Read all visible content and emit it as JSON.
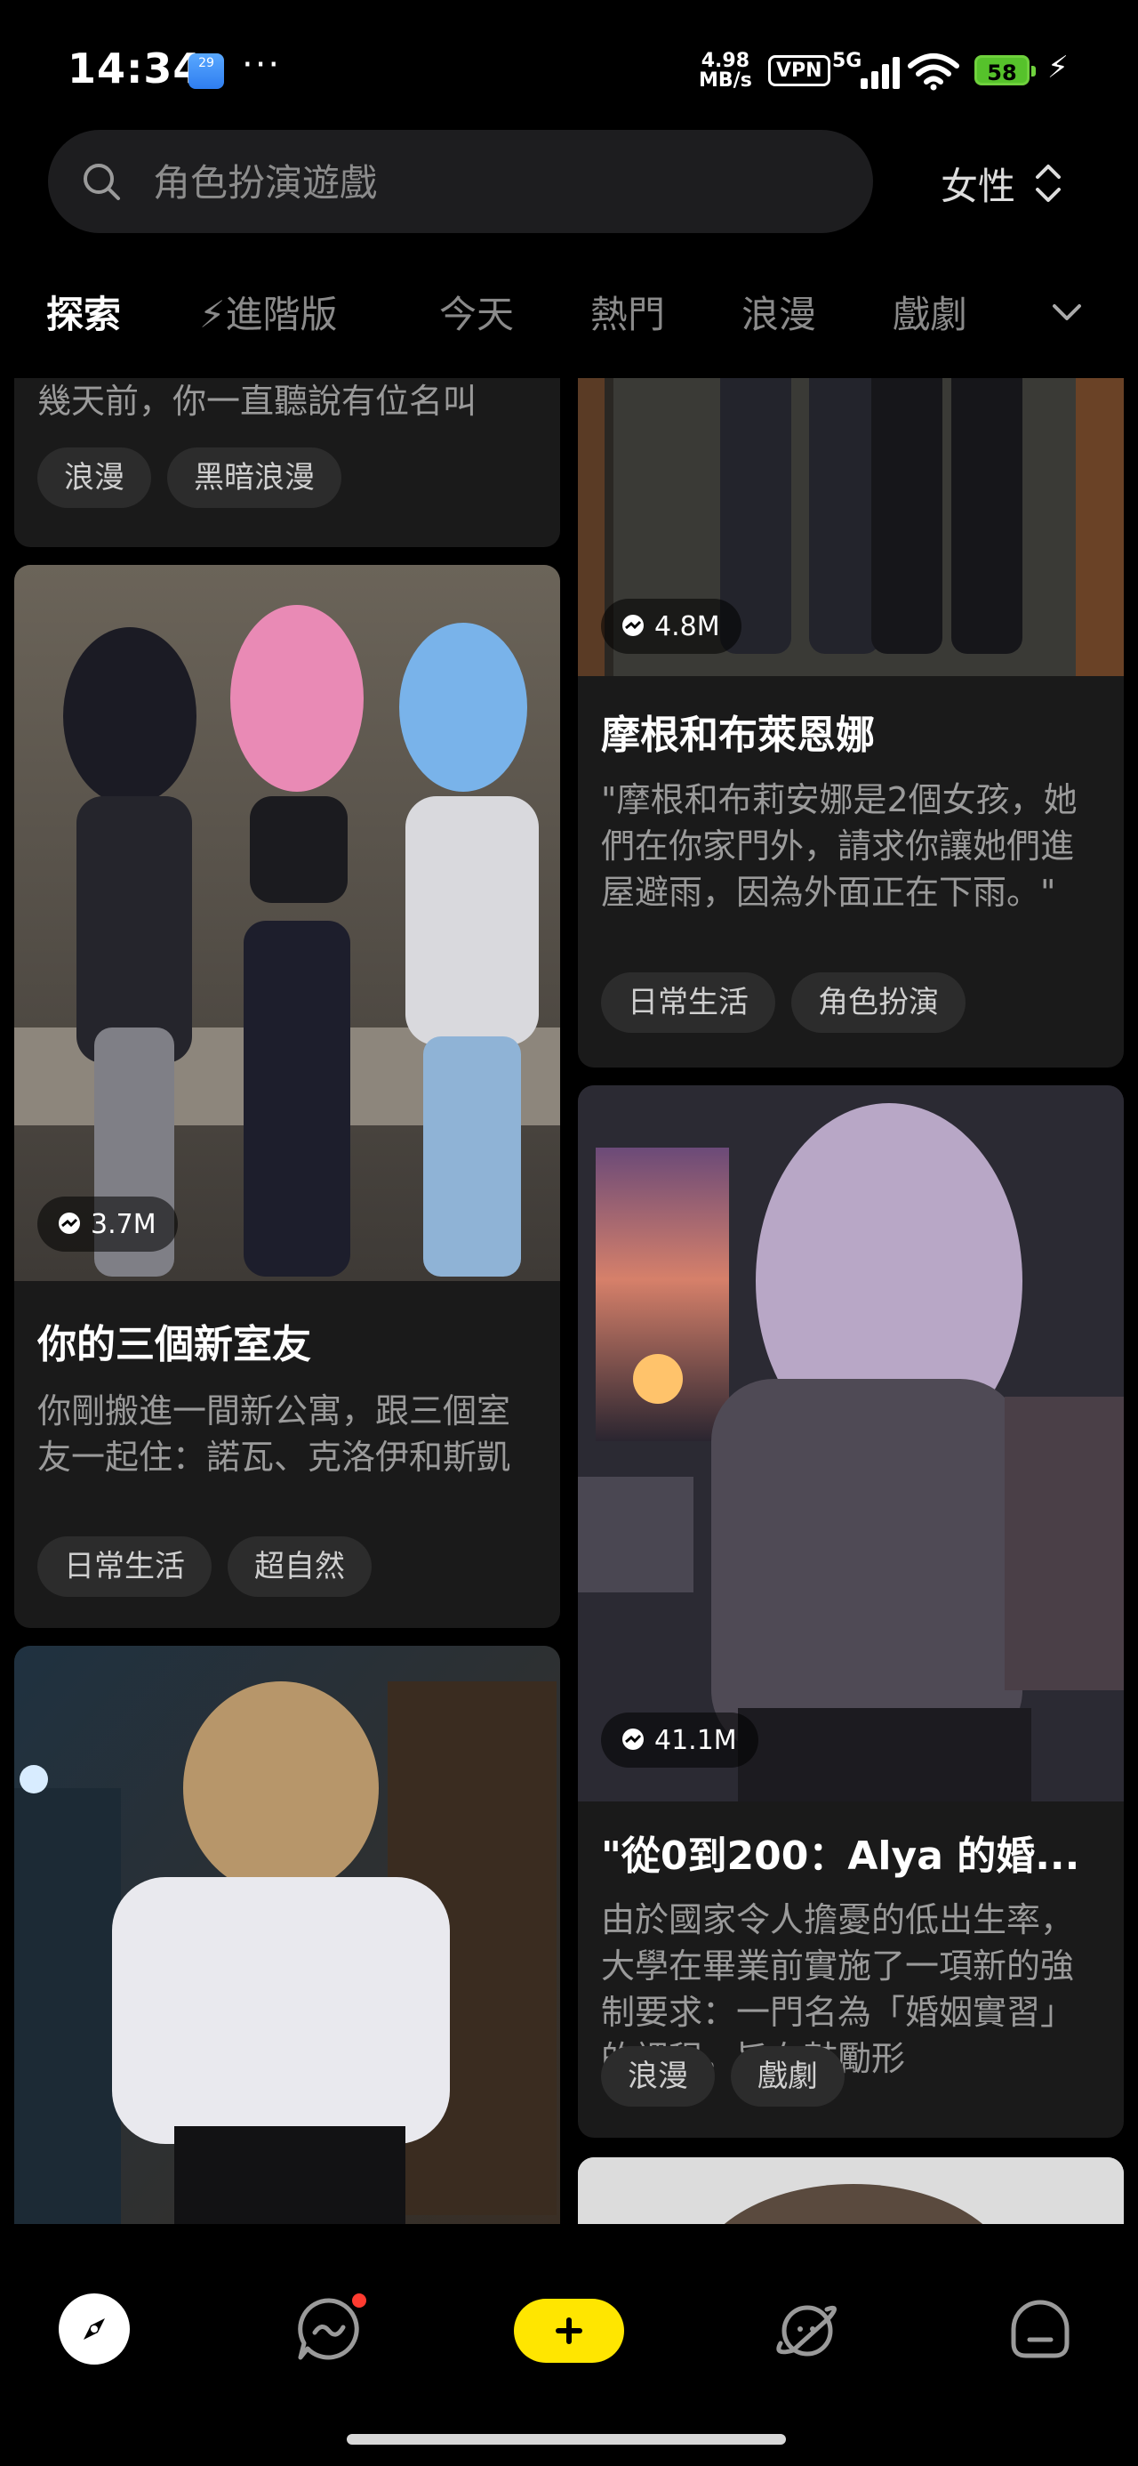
{
  "status": {
    "time": "14:34",
    "calendar_day": "29",
    "speed_value": "4.98",
    "speed_unit": "MB/s",
    "vpn": "VPN",
    "network": "5G",
    "battery": "58"
  },
  "search": {
    "placeholder": "角色扮演遊戲"
  },
  "gender": {
    "label": "女性"
  },
  "tabs": [
    "探索",
    "⚡進階版",
    "今天",
    "熱門",
    "浪漫",
    "戲劇"
  ],
  "cards": [
    {
      "desc": "幾天前，你一直聽說有位名叫",
      "tags": [
        "浪漫",
        "黑暗浪漫"
      ]
    },
    {
      "plays": "3.7M",
      "title": "你的三個新室友",
      "desc": "你剛搬進一間新公寓，跟三個室友一起住：諾瓦、克洛伊和斯凱",
      "tags": [
        "日常生活",
        "超自然"
      ]
    },
    {
      "plays": "4.8M",
      "title": "摩根和布萊恩娜",
      "desc": "\"摩根和布莉安娜是2個女孩，她們在你家門外，請求你讓她們進屋避雨，因為外面正在下雨。\"",
      "tags": [
        "日常生活",
        "角色扮演"
      ]
    },
    {
      "plays": "41.1M",
      "title": "\"從0到200：Alya 的婚...",
      "desc": "由於國家令人擔憂的低出生率，大學在畢業前實施了一項新的強制要求：一門名為「婚姻實習」的課程，旨在鼓勵形",
      "tags": [
        "浪漫",
        "戲劇"
      ]
    }
  ],
  "colors": {
    "accent": "#ffe600",
    "background": "#000000",
    "card": "#1a1a1a"
  }
}
